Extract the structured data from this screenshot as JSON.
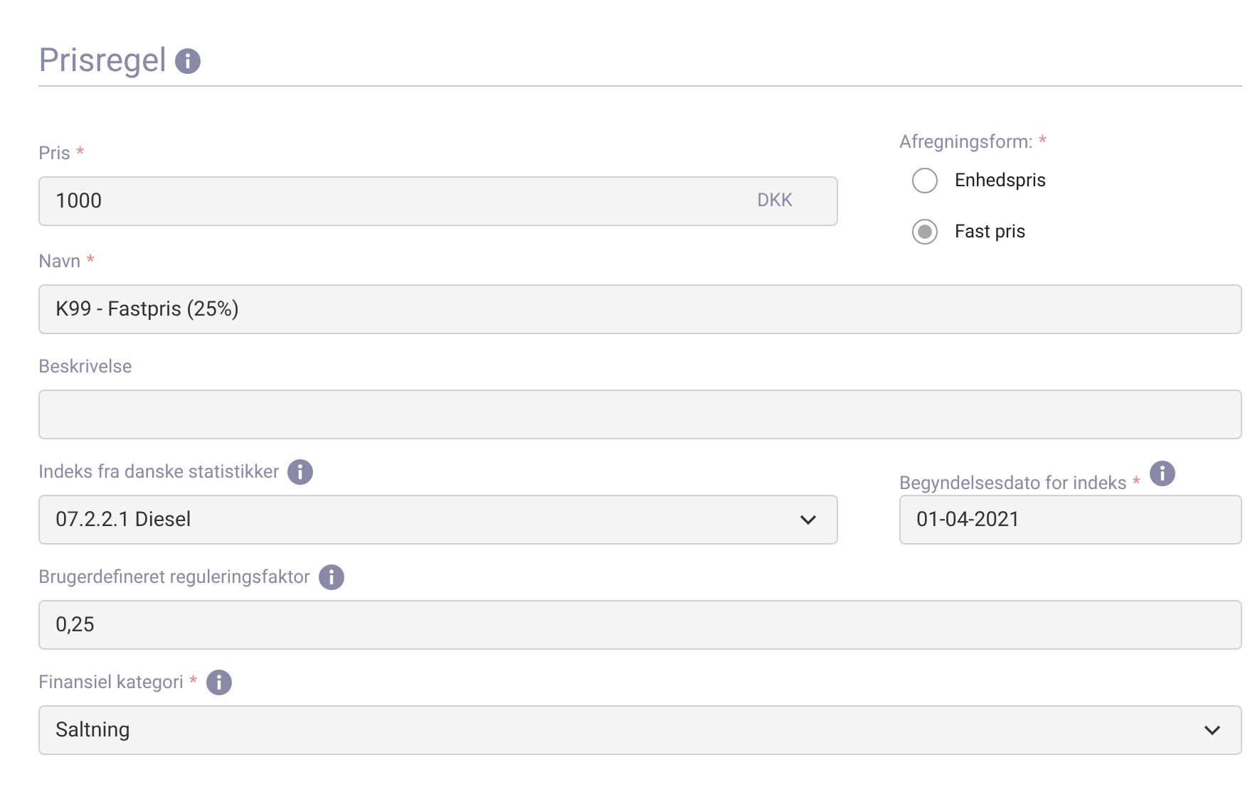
{
  "title": {
    "text": "Prisregel",
    "info": true
  },
  "price": {
    "label": "Pris",
    "required_mark": "*",
    "value": "1000",
    "unit": "DKK",
    "kind": "text"
  },
  "settlement": {
    "label": "Afregningsform:",
    "required_mark": "*",
    "options": [
      {
        "label": "Enhedspris",
        "selected": false
      },
      {
        "label": "Fast pris",
        "selected": true
      }
    ]
  },
  "name": {
    "label": "Navn",
    "required_mark": "*",
    "value": "K99 - Fastpris (25%)",
    "kind": "text"
  },
  "description": {
    "label": "Beskrivelse",
    "kind": "text"
  },
  "index": {
    "label": "Indeks fra danske statistikker",
    "info": true,
    "value": "07.2.2.1 Diesel",
    "kind": "select"
  },
  "index_start_date": {
    "label": "Begyndelsesdato for indeks",
    "required_mark": "*",
    "info": true,
    "value": "01-04-2021",
    "kind": "text"
  },
  "factor": {
    "label": "Brugerdefineret reguleringsfaktor",
    "info": true,
    "value": "0,25",
    "kind": "text"
  },
  "category": {
    "label": "Finansiel kategori",
    "required_mark": "*",
    "info": true,
    "value": "Saltning",
    "kind": "select"
  }
}
